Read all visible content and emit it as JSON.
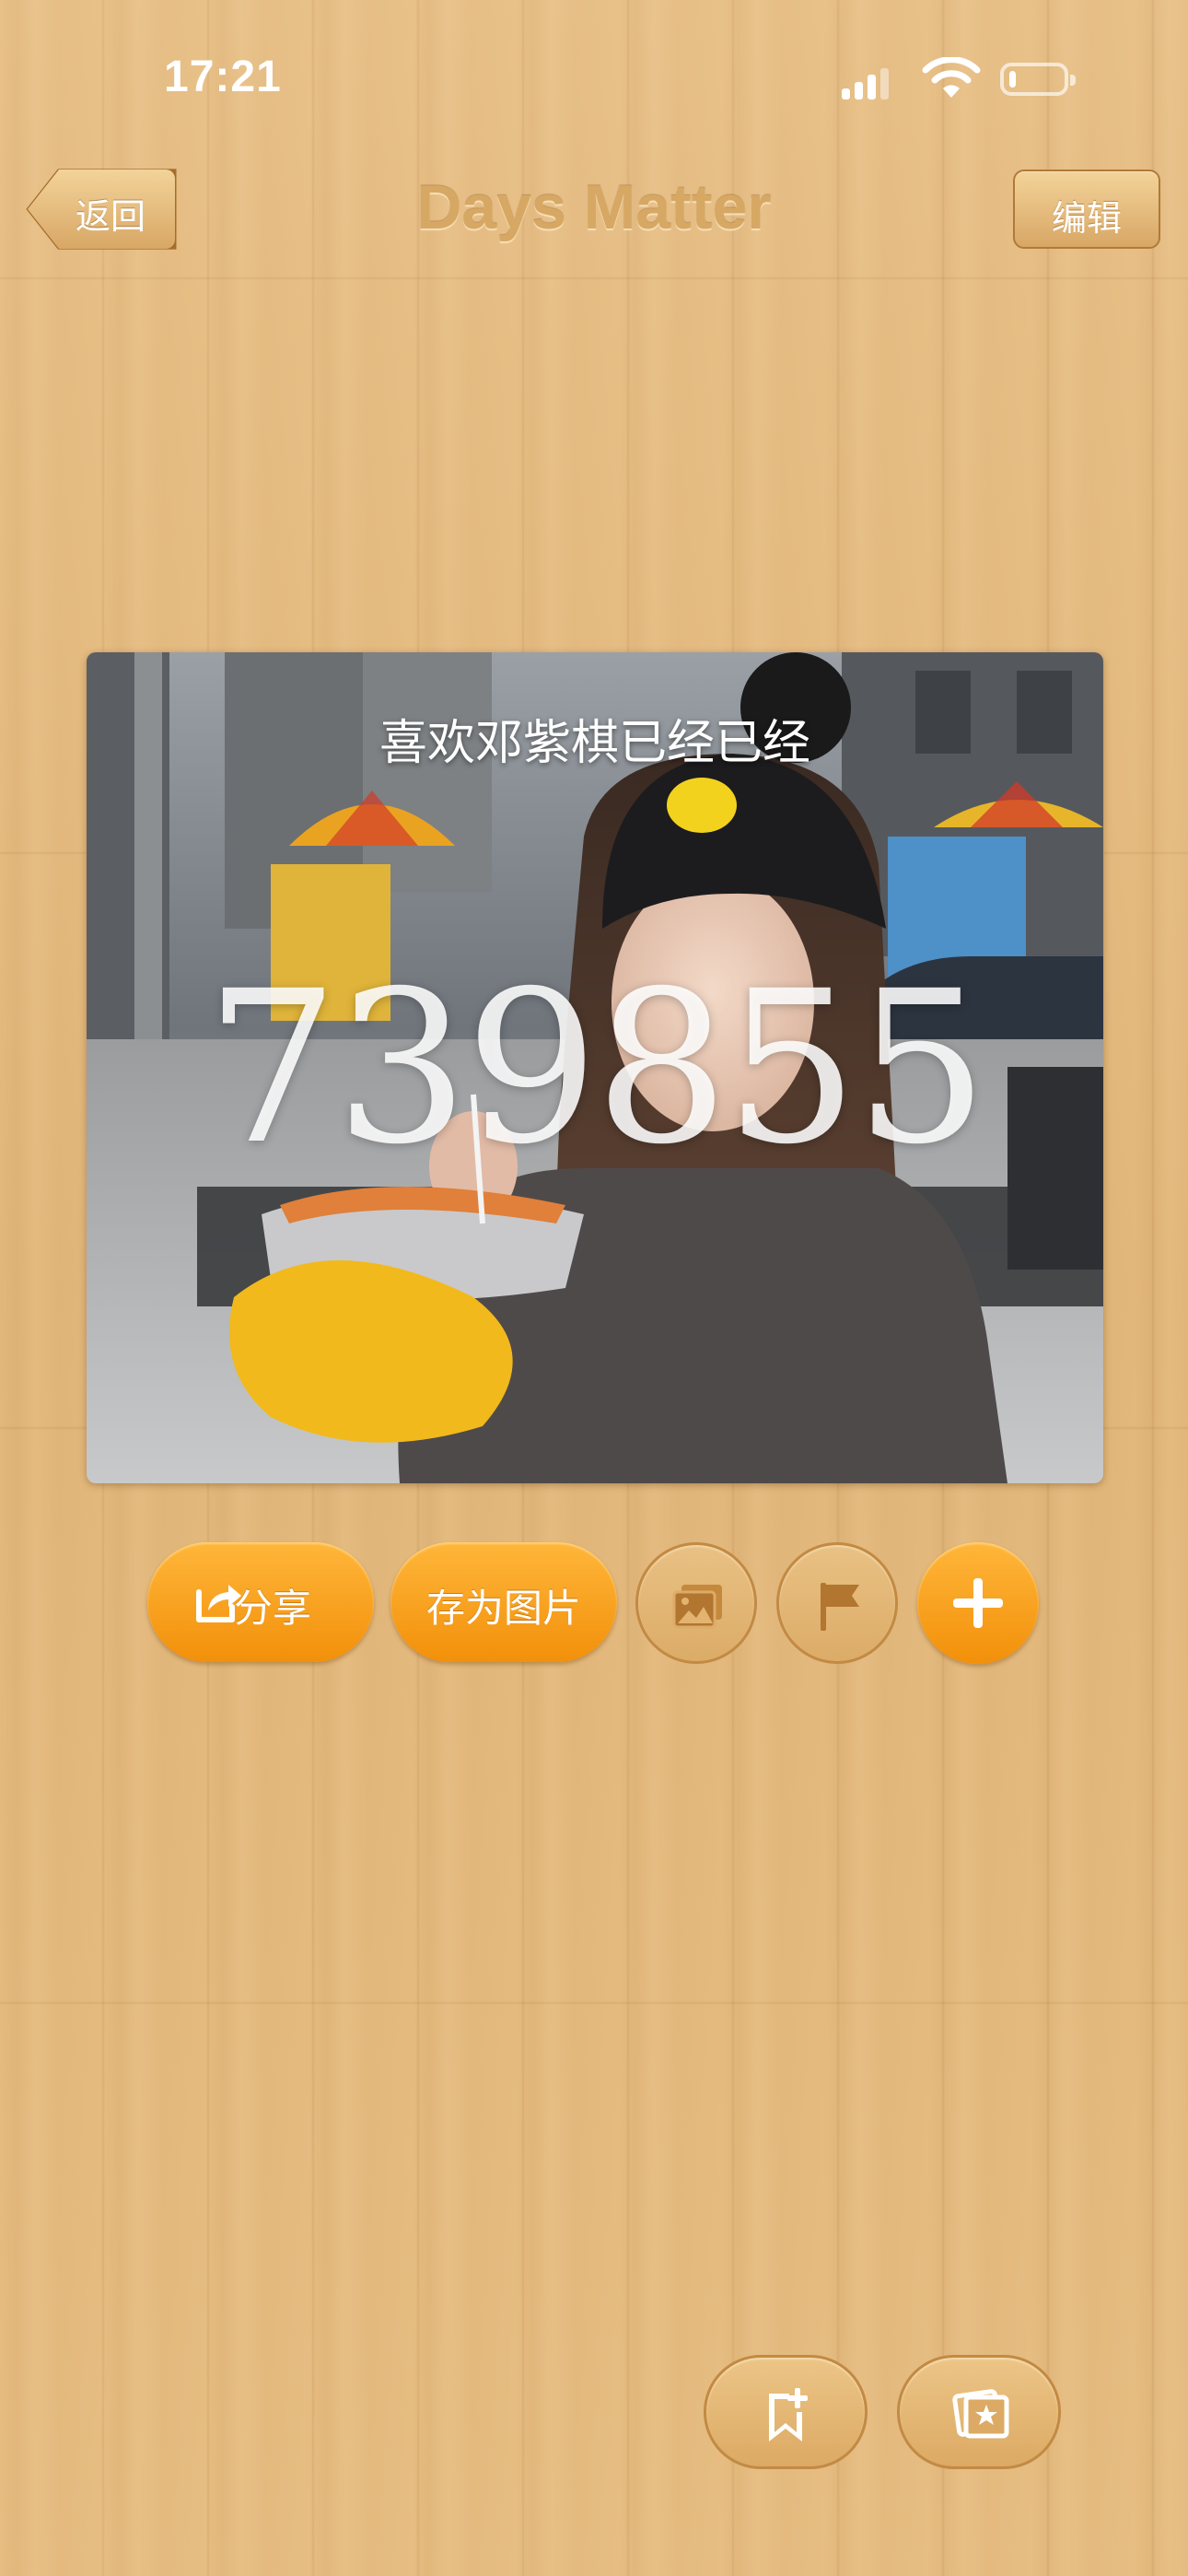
{
  "status_bar": {
    "time": "17:21",
    "battery_level": 0.12
  },
  "nav": {
    "back_label": "返回",
    "title": "Days Matter",
    "edit_label": "编辑"
  },
  "card": {
    "event_title": "喜欢邓紫棋已经已经",
    "day_count": "739855"
  },
  "actions": {
    "share_label": "分享",
    "save_image_label": "存为图片"
  },
  "icons": {
    "share": "share-icon",
    "photo": "photo-icon",
    "flag": "flag-icon",
    "add": "plus-icon",
    "bottom_add": "bookmark-add-icon",
    "gallery": "gallery-star-icon"
  },
  "colors": {
    "accent_orange": "#f5a020",
    "wood": "#e6bd82",
    "title_tan": "#d7a863"
  }
}
